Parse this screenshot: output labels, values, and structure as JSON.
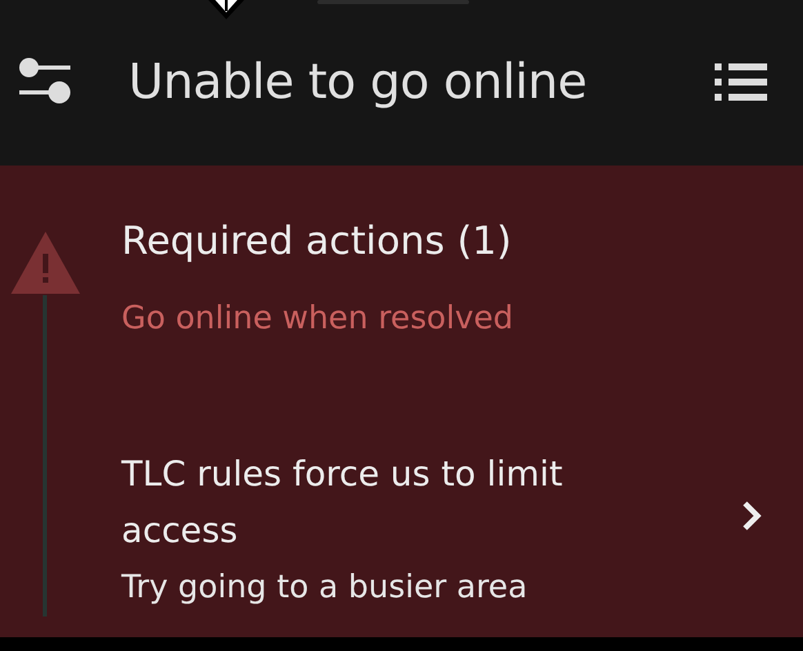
{
  "header": {
    "title": "Unable to go online"
  },
  "required": {
    "title": "Required actions (1)",
    "subtitle": "Go online when resolved"
  },
  "actions": [
    {
      "title": "TLC rules force us to limit access",
      "detail": "Try going to a busier area"
    }
  ]
}
